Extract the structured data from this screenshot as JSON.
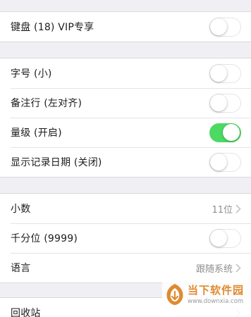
{
  "section1": {
    "rows": [
      {
        "label": "键盘 (18) VIP专享",
        "toggle": false
      }
    ]
  },
  "section2": {
    "rows": [
      {
        "label": "字号 (小)",
        "toggle": false
      },
      {
        "label": "备注行 (左对齐)",
        "toggle": false
      },
      {
        "label": "量级 (开启)",
        "toggle": true
      },
      {
        "label": "显示记录日期 (关闭)",
        "toggle": false
      }
    ]
  },
  "section3": {
    "decimal": {
      "label": "小数",
      "value": "11位"
    },
    "thousands": {
      "label": "千分位 (9999)",
      "toggle": false
    },
    "language": {
      "label": "语言",
      "value": "跟随系统"
    }
  },
  "section4": {
    "recycle": {
      "label": "回收站"
    }
  },
  "watermark": {
    "title": "当下软件园",
    "url": "www.downxia.com"
  },
  "colors": {
    "background": "#efeff4",
    "toggle_on": "#4cd964",
    "secondary_text": "#8e8e93",
    "watermark_orange": "#e08a2e"
  }
}
